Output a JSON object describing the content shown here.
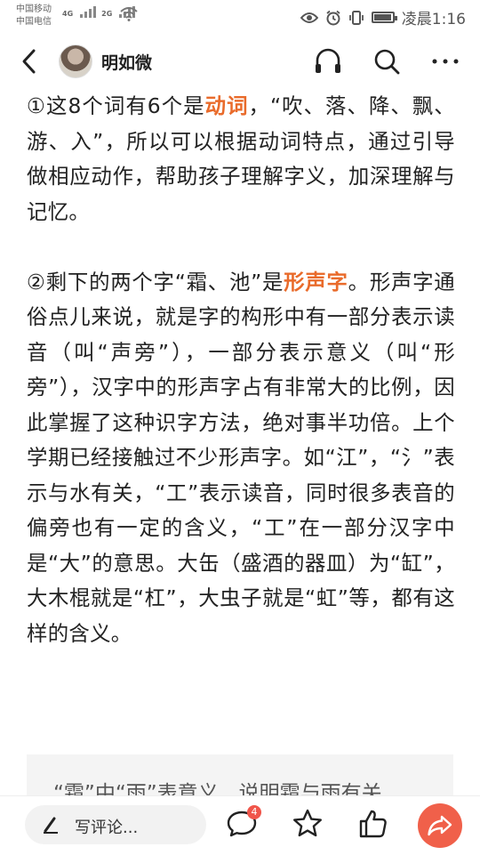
{
  "status_bar": {
    "carrier_1": "中国移动",
    "carrier_2": "中国电信",
    "net_1": "4G",
    "net_2": "2G",
    "time": "凌晨1:16"
  },
  "header": {
    "author_name": "明如微"
  },
  "article": {
    "para1": {
      "pre": "①这8个词有6个是",
      "highlight": "动词",
      "post": "，“吹、落、降、飘、游、入”，所以可以根据动词特点，通过引导做相应动作，帮助孩子理解字义，加深理解与记忆。"
    },
    "para2": {
      "pre": "②剩下的两个字“霜、池”是",
      "highlight": "形声字",
      "post": "。形声字通俗点儿来说，就是字的构形中有一部分表示读音（叫“声旁”），一部分表示意义（叫“形旁”），汉字中的形声字占有非常大的比例，因此掌握了这种识字方法，绝对事半功倍。上个学期已经接触过不少形声字。如“江”，“氵”表示与水有关，“工”表示读音，同时很多表音的偏旁也有一定的含义，“工”在一部分汉字中是“大”的意思。大缶（盛酒的器皿）为“缸”，大木棍就是“杠”，大虫子就是“虹”等，都有这样的含义。"
    },
    "quote_partial": "“霜”中“雨”表意义，说明霜与雨有关"
  },
  "bottom_bar": {
    "comment_placeholder": "写评论...",
    "comment_count": "4"
  },
  "colors": {
    "highlight": "#e96b2b",
    "share": "#f0604a",
    "badge": "#f0554a"
  }
}
